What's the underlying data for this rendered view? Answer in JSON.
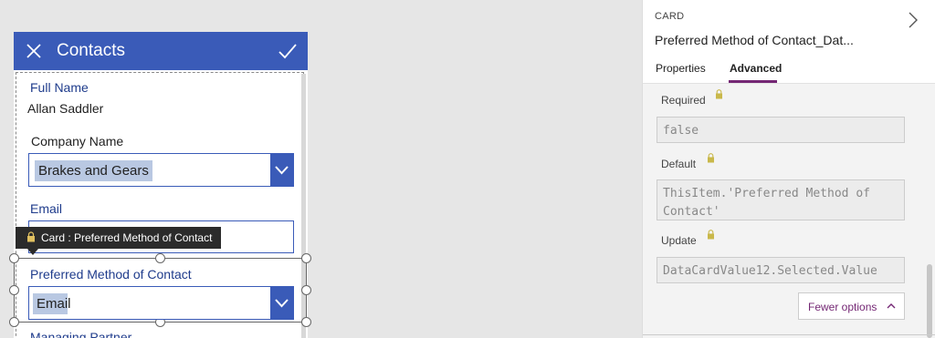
{
  "form": {
    "title": "Contacts",
    "fields": {
      "full_name_label": "Full Name",
      "full_name_value": "Allan Saddler",
      "company_label": "Company Name",
      "company_value": "Brakes and Gears",
      "email_label": "Email",
      "pref_label": "Preferred Method of Contact",
      "pref_value": "Email",
      "next_label": "Managing Partner"
    },
    "tooltip": "Card : Preferred Method of Contact"
  },
  "pane": {
    "section": "CARD",
    "card_name": "Preferred Method of Contact_Dat...",
    "tabs": [
      "Properties",
      "Advanced"
    ],
    "active_tab": "Advanced",
    "props": [
      {
        "label": "Required",
        "value": "false"
      },
      {
        "label": "Default",
        "value": "ThisItem.'Preferred Method of Contact'"
      },
      {
        "label": "Update",
        "value": "DataCardValue12.Selected.Value"
      }
    ],
    "fewer_options": "Fewer options"
  },
  "colors": {
    "accent_blue": "#3a5bb8",
    "label_blue": "#1f3c8c",
    "tab_purple": "#742774"
  }
}
